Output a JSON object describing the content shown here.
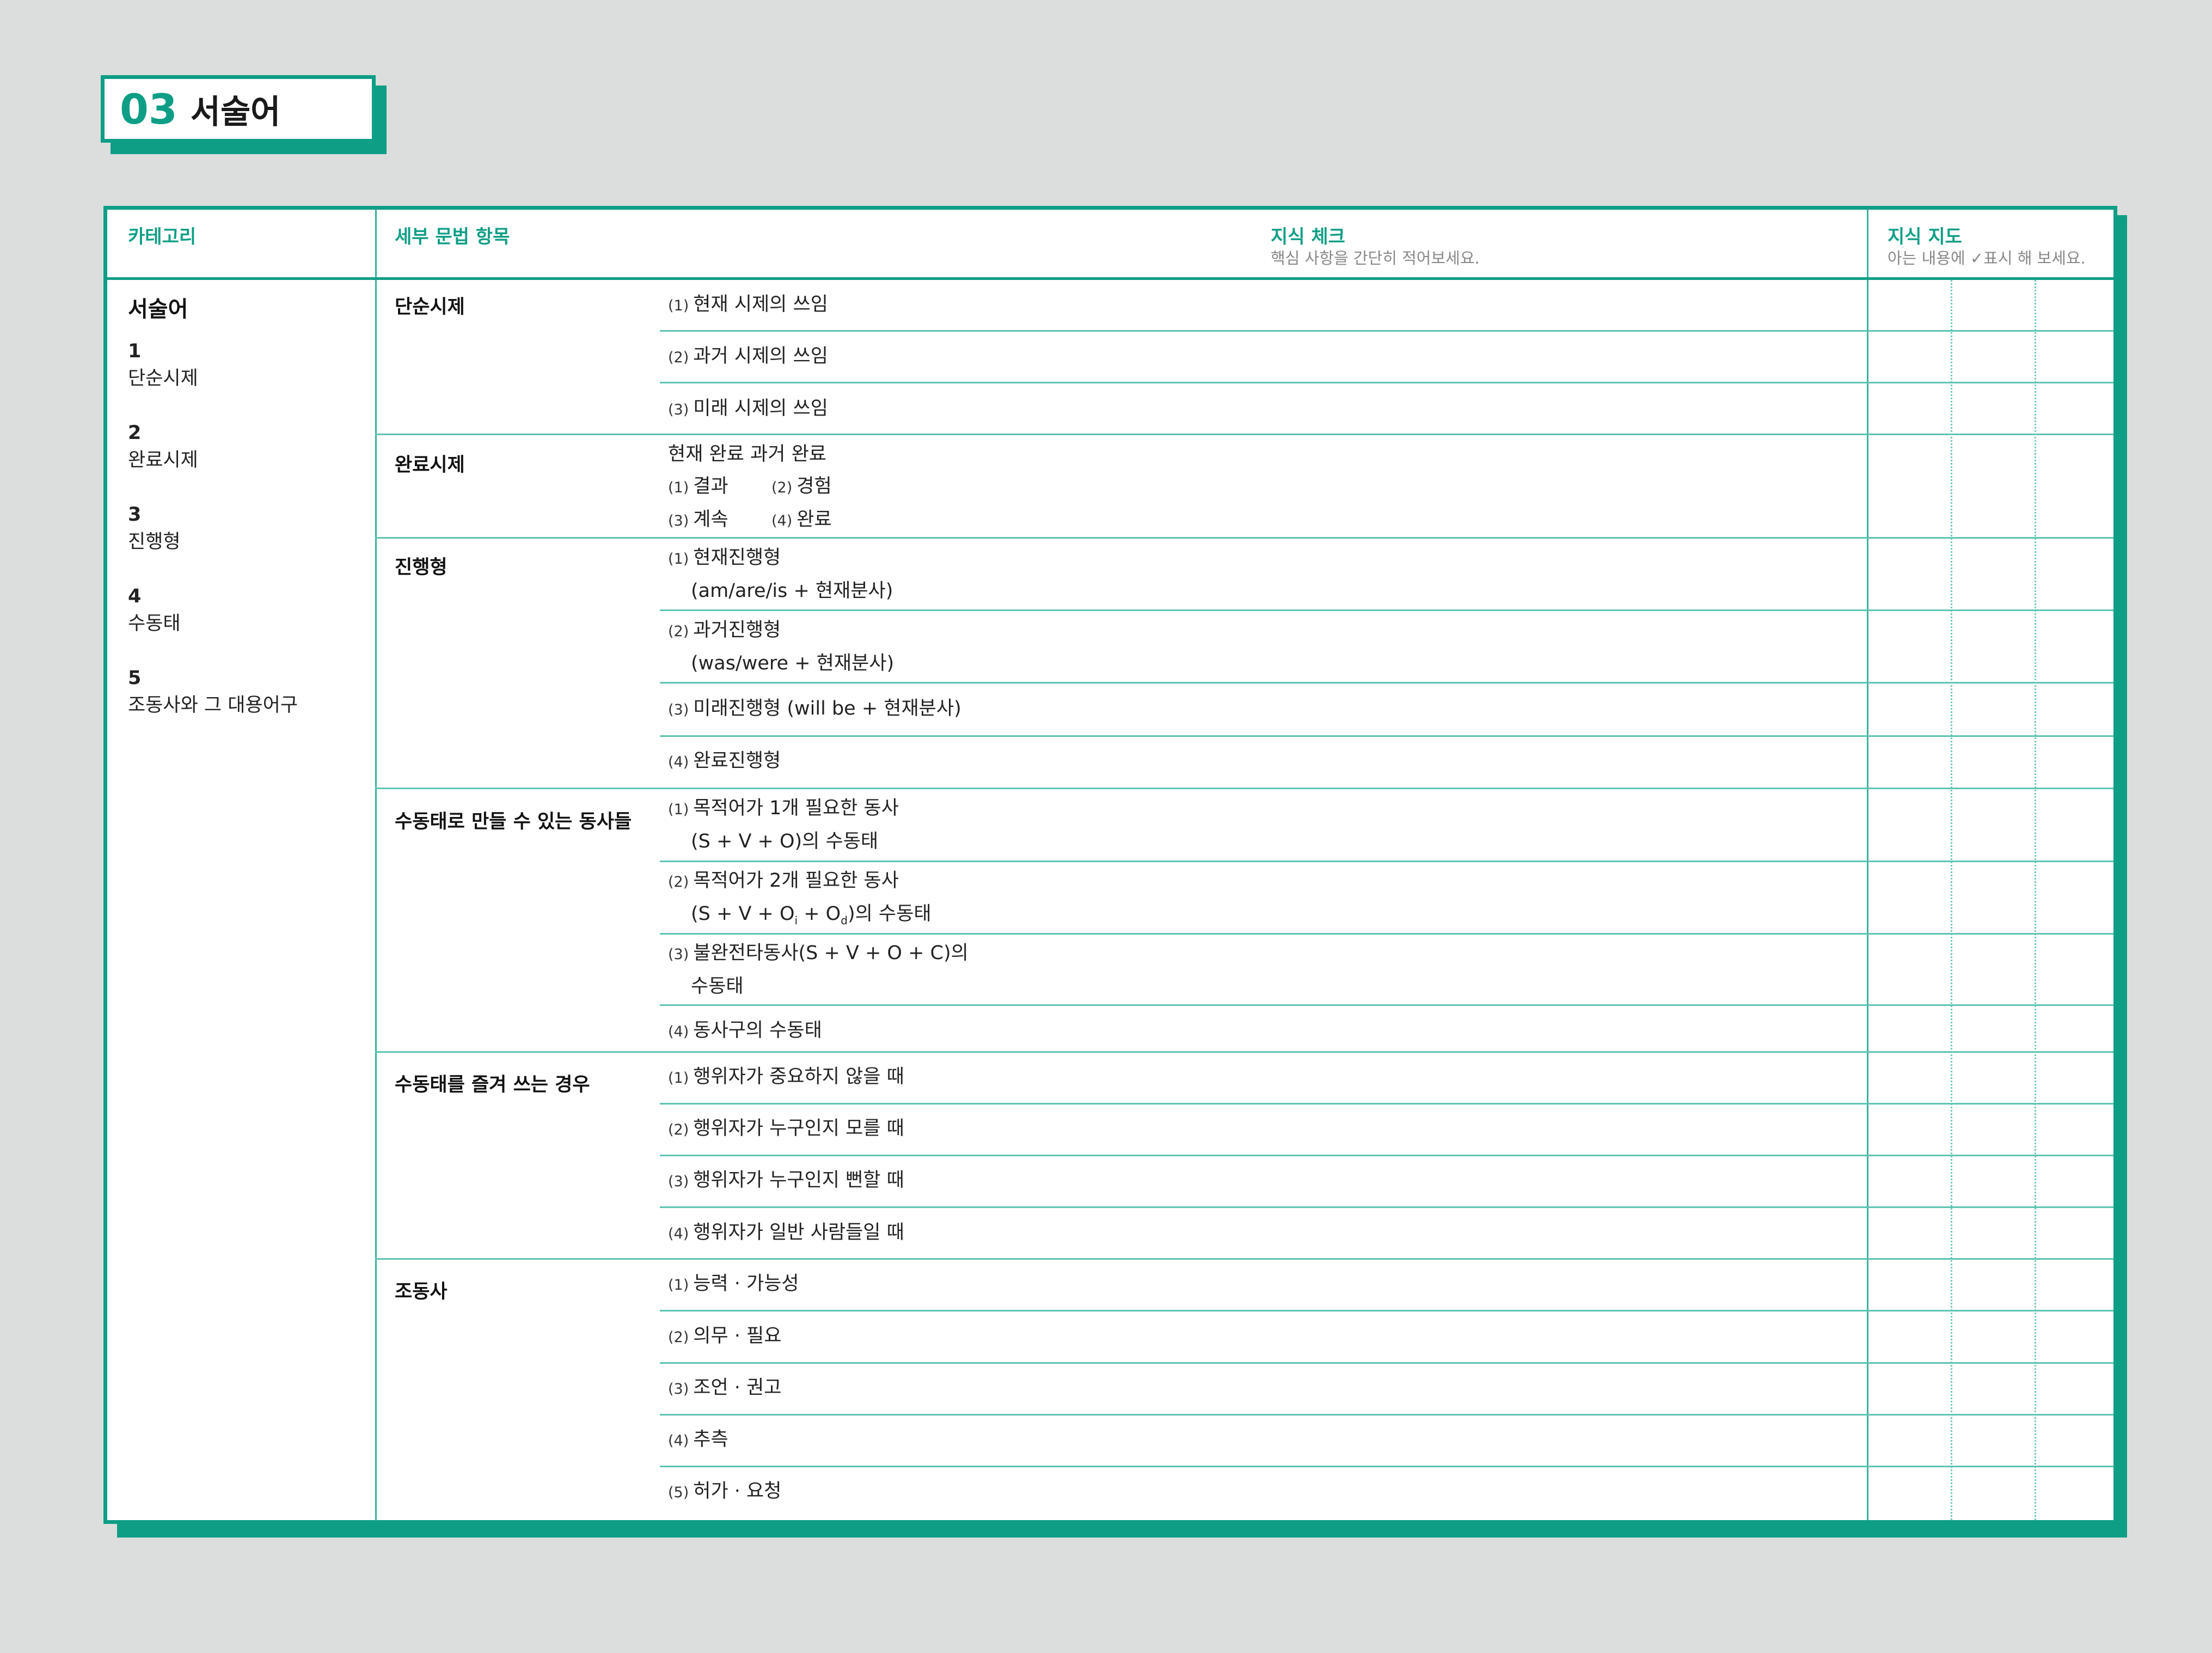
{
  "title": {
    "number": "03",
    "text": "서술어"
  },
  "header": {
    "category": "카테고리",
    "detail": "세부 문법 항목",
    "check_title": "지식 체크",
    "check_sub": "핵심 사항을 간단히 적어보세요.",
    "map_title": "지식 지도",
    "map_sub": "아는 내용에 ✓표시 해 보세요."
  },
  "category": {
    "title": "서술어",
    "items": [
      {
        "n": "1",
        "label": "단순시제"
      },
      {
        "n": "2",
        "label": "완료시제"
      },
      {
        "n": "3",
        "label": "진행형"
      },
      {
        "n": "4",
        "label": "수동태"
      },
      {
        "n": "5",
        "label": "조동사와 그 대용어구"
      }
    ]
  },
  "sections": [
    {
      "label": "단순시제"
    },
    {
      "label": "완료시제"
    },
    {
      "label": "진행형"
    },
    {
      "label": "수동태로 만들 수 있는 동사들"
    },
    {
      "label": "수동태를 즐겨 쓰는 경우"
    },
    {
      "label": "조동사"
    }
  ],
  "rows": {
    "simple": [
      {
        "num": "(1)",
        "text": "현재 시제의 쓰임"
      },
      {
        "num": "(2)",
        "text": "과거 시제의 쓰임"
      },
      {
        "num": "(3)",
        "text": "미래 시제의 쓰임"
      }
    ],
    "perfect": {
      "head": "현재 완료 과거 완료",
      "items": [
        {
          "num": "(1)",
          "text": "결과"
        },
        {
          "num": "(2)",
          "text": "경험"
        },
        {
          "num": "(3)",
          "text": "계속"
        },
        {
          "num": "(4)",
          "text": "완료"
        }
      ]
    },
    "progressive": [
      {
        "num": "(1)",
        "text": "현재진행형",
        "cont": "(am/are/is + 현재분사)"
      },
      {
        "num": "(2)",
        "text": "과거진행형",
        "cont": "(was/were + 현재분사)"
      },
      {
        "num": "(3)",
        "text": "미래진행형 (will be + 현재분사)"
      },
      {
        "num": "(4)",
        "text": "완료진행형"
      }
    ],
    "passive_verbs": [
      {
        "num": "(1)",
        "text": "목적어가 1개 필요한 동사",
        "cont": "(S + V + O)의 수동태"
      },
      {
        "num": "(2)",
        "text": "목적어가 2개 필요한 동사",
        "cont_a": "(S + V + O",
        "sub_i": "i",
        "cont_b": " + O",
        "sub_d": "d",
        "cont_c": ")의 수동태"
      },
      {
        "num": "(3)",
        "text": "불완전타동사(S + V + O + C)의",
        "cont": "수동태"
      },
      {
        "num": "(4)",
        "text": "동사구의 수동태"
      }
    ],
    "passive_use": [
      {
        "num": "(1)",
        "text": "행위자가 중요하지 않을 때"
      },
      {
        "num": "(2)",
        "text": "행위자가 누구인지 모를 때"
      },
      {
        "num": "(3)",
        "text": "행위자가 누구인지 뻔할 때"
      },
      {
        "num": "(4)",
        "text": "행위자가 일반 사람들일 때"
      }
    ],
    "modal": [
      {
        "num": "(1)",
        "text": "능력 · 가능성"
      },
      {
        "num": "(2)",
        "text": "의무 · 필요"
      },
      {
        "num": "(3)",
        "text": "조언 · 권고"
      },
      {
        "num": "(4)",
        "text": "추측"
      },
      {
        "num": "(5)",
        "text": "허가 · 요청"
      }
    ]
  },
  "colors": {
    "accent": "#0e9e86",
    "line": "#5cc4b2",
    "background": "#dcdedd"
  }
}
